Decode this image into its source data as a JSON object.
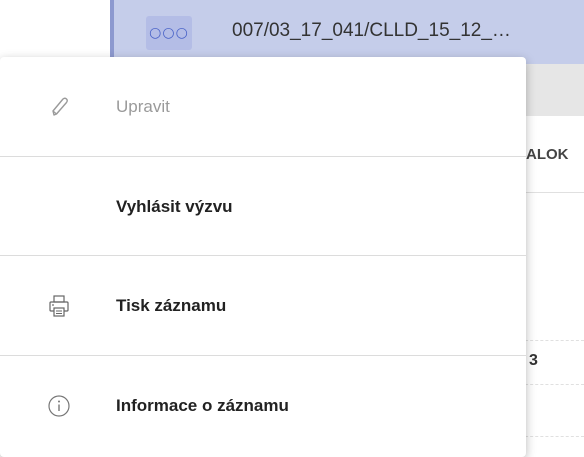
{
  "row": {
    "more_label": "○○○",
    "record_id": "007/03_17_041/CLLD_15_12_…"
  },
  "table": {
    "column_header": "ALOK",
    "cell_value": "3"
  },
  "menu": {
    "items": [
      {
        "label": "Upravit",
        "icon": "pencil-icon",
        "disabled": true
      },
      {
        "label": "Vyhlásit výzvu",
        "icon": "none",
        "disabled": false
      },
      {
        "label": "Tisk záznamu",
        "icon": "printer-icon",
        "disabled": false
      },
      {
        "label": "Informace o záznamu",
        "icon": "info-icon",
        "disabled": false
      }
    ]
  },
  "colors": {
    "selected_row": "#c5cdea",
    "more_button": "#b4bde6",
    "accent": "#4a63c8",
    "disabled_text": "#9a9a9a"
  }
}
